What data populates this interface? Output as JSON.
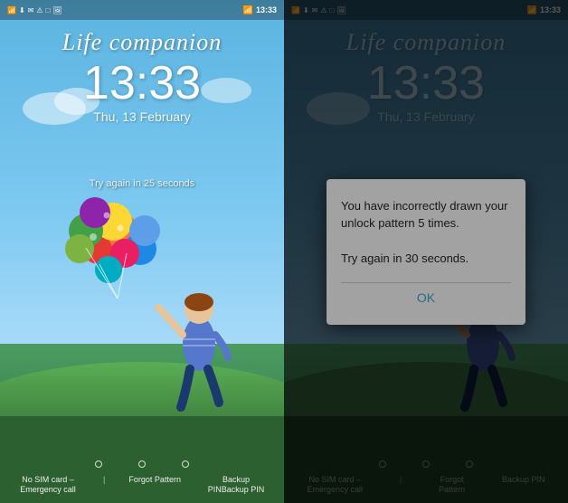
{
  "left_screen": {
    "status_bar": {
      "time": "13:33",
      "icons_left": [
        "notification",
        "download",
        "gmail",
        "warning",
        "screen",
        "photo"
      ],
      "icons_right": [
        "wifi",
        "signal",
        "battery"
      ]
    },
    "tagline": "Life companion",
    "time": "13:33",
    "date": "Thu, 13 February",
    "try_again_msg": "Try again in 25 seconds",
    "dots": [
      "dot1",
      "dot2",
      "dot3"
    ],
    "bottom_links": [
      {
        "text": "No SIM card –\nEmergency call",
        "has_divider": true
      },
      {
        "text": "Forgot\nPattern",
        "has_divider": true
      },
      {
        "text": "Backup PIN",
        "has_divider": false
      }
    ]
  },
  "right_screen": {
    "status_bar": {
      "time": "13:33"
    },
    "tagline": "Life companion",
    "time": "13:33",
    "date": "Thu, 13 February",
    "dialog": {
      "message": "You have incorrectly drawn your unlock pattern 5 times.\n\nTry again in 30 seconds.",
      "ok_label": "OK"
    },
    "dots": [
      "dot1",
      "dot2",
      "dot3"
    ],
    "bottom_links": [
      {
        "text": "No SIM card –\nEmergency call"
      },
      {
        "text": "Forgot\nPattern"
      },
      {
        "text": "Backup PIN"
      }
    ]
  }
}
